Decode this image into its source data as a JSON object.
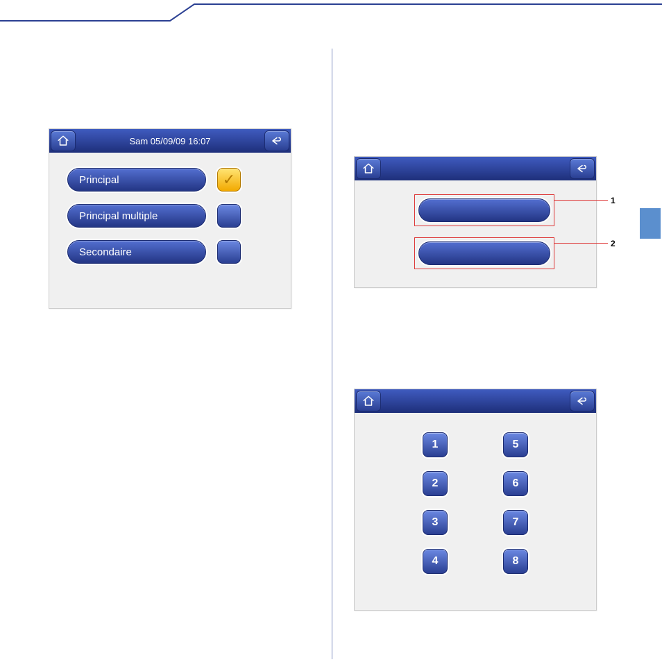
{
  "colors": {
    "brand_dark": "#2a3f92",
    "brand_light": "#5a7ad6",
    "accent_yellow": "#f2a900",
    "callout_red": "#d33"
  },
  "panel_a": {
    "titlebar_text": "Sam 05/09/09 16:07",
    "options": [
      {
        "label": "Principal",
        "checked": true
      },
      {
        "label": "Principal multiple",
        "checked": false
      },
      {
        "label": "Secondaire",
        "checked": false
      }
    ]
  },
  "panel_b": {
    "callouts": [
      {
        "number": "1"
      },
      {
        "number": "2"
      }
    ]
  },
  "panel_c": {
    "keys_left": [
      "1",
      "2",
      "3",
      "4"
    ],
    "keys_right": [
      "5",
      "6",
      "7",
      "8"
    ]
  },
  "icon_names": {
    "home": "home-icon",
    "back": "back-arrow-icon",
    "check": "checkmark-icon"
  }
}
